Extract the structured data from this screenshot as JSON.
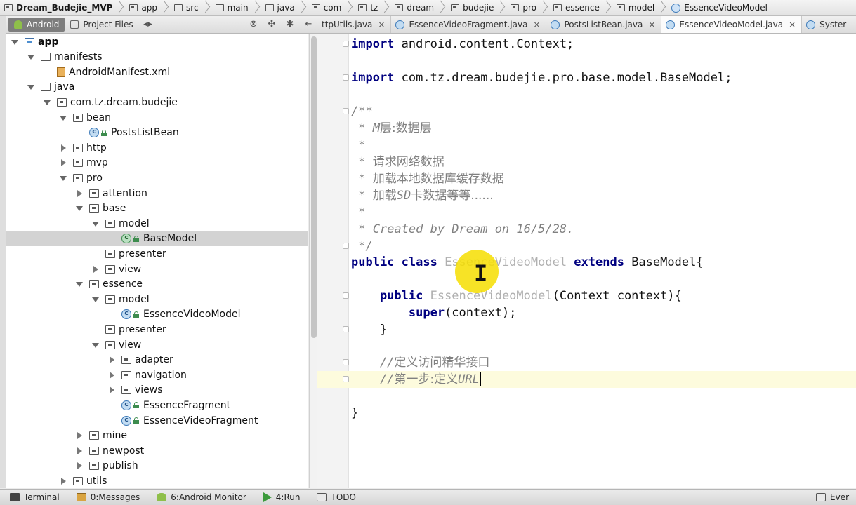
{
  "breadcrumb": [
    {
      "label": "Dream_Budejie_MVP",
      "icon": "module-folder-icon"
    },
    {
      "label": "app",
      "icon": "module-folder-icon"
    },
    {
      "label": "src",
      "icon": "folder-icon"
    },
    {
      "label": "main",
      "icon": "folder-icon"
    },
    {
      "label": "java",
      "icon": "folder-icon"
    },
    {
      "label": "com",
      "icon": "package-icon"
    },
    {
      "label": "tz",
      "icon": "package-icon"
    },
    {
      "label": "dream",
      "icon": "package-icon"
    },
    {
      "label": "budejie",
      "icon": "package-icon"
    },
    {
      "label": "pro",
      "icon": "package-icon"
    },
    {
      "label": "essence",
      "icon": "package-icon"
    },
    {
      "label": "model",
      "icon": "package-icon"
    },
    {
      "label": "EssenceVideoModel",
      "icon": "class-icon"
    }
  ],
  "left_panel": {
    "tab_android": "Android",
    "tab_project_files": "Project Files"
  },
  "tree": [
    {
      "label": "app",
      "arrow": "down",
      "icon": "module",
      "indent": 0,
      "bold": true
    },
    {
      "label": "manifests",
      "arrow": "down",
      "icon": "folder",
      "indent": 1
    },
    {
      "label": "AndroidManifest.xml",
      "arrow": "none",
      "icon": "xml",
      "indent": 2
    },
    {
      "label": "java",
      "arrow": "down",
      "icon": "folder",
      "indent": 1
    },
    {
      "label": "com.tz.dream.budejie",
      "arrow": "down",
      "icon": "package",
      "indent": 2
    },
    {
      "label": "bean",
      "arrow": "down",
      "icon": "package",
      "indent": 3
    },
    {
      "label": "PostsListBean",
      "arrow": "none",
      "icon": "class",
      "indent": 4
    },
    {
      "label": "http",
      "arrow": "right",
      "icon": "package",
      "indent": 3
    },
    {
      "label": "mvp",
      "arrow": "right",
      "icon": "package",
      "indent": 3
    },
    {
      "label": "pro",
      "arrow": "down",
      "icon": "package",
      "indent": 3
    },
    {
      "label": "attention",
      "arrow": "right",
      "icon": "package",
      "indent": 4
    },
    {
      "label": "base",
      "arrow": "down",
      "icon": "package",
      "indent": 4
    },
    {
      "label": "model",
      "arrow": "down",
      "icon": "package",
      "indent": 5
    },
    {
      "label": "BaseModel",
      "arrow": "none",
      "icon": "abstract-class",
      "indent": 6,
      "selected": true
    },
    {
      "label": "presenter",
      "arrow": "none",
      "icon": "package",
      "indent": 5
    },
    {
      "label": "view",
      "arrow": "right",
      "icon": "package",
      "indent": 5
    },
    {
      "label": "essence",
      "arrow": "down",
      "icon": "package",
      "indent": 4
    },
    {
      "label": "model",
      "arrow": "down",
      "icon": "package",
      "indent": 5
    },
    {
      "label": "EssenceVideoModel",
      "arrow": "none",
      "icon": "class",
      "indent": 6
    },
    {
      "label": "presenter",
      "arrow": "none",
      "icon": "package",
      "indent": 5
    },
    {
      "label": "view",
      "arrow": "down",
      "icon": "package",
      "indent": 5
    },
    {
      "label": "adapter",
      "arrow": "right",
      "icon": "package",
      "indent": 6
    },
    {
      "label": "navigation",
      "arrow": "right",
      "icon": "package",
      "indent": 6
    },
    {
      "label": "views",
      "arrow": "right",
      "icon": "package",
      "indent": 6
    },
    {
      "label": "EssenceFragment",
      "arrow": "none",
      "icon": "class",
      "indent": 6
    },
    {
      "label": "EssenceVideoFragment",
      "arrow": "none",
      "icon": "class",
      "indent": 6
    },
    {
      "label": "mine",
      "arrow": "right",
      "icon": "package",
      "indent": 4
    },
    {
      "label": "newpost",
      "arrow": "right",
      "icon": "package",
      "indent": 4
    },
    {
      "label": "publish",
      "arrow": "right",
      "icon": "package",
      "indent": 4
    },
    {
      "label": "utils",
      "arrow": "right",
      "icon": "package",
      "indent": 3
    }
  ],
  "editor_tabs": [
    {
      "label": "ttpUtils.java",
      "close": "×",
      "active": false
    },
    {
      "label": "EssenceVideoFragment.java",
      "close": "×",
      "active": false
    },
    {
      "label": "PostsListBean.java",
      "close": "×",
      "active": false
    },
    {
      "label": "EssenceVideoModel.java",
      "close": "×",
      "active": true
    },
    {
      "label": "Syster",
      "close": "",
      "active": false
    }
  ],
  "code": {
    "l1_kw": "import",
    "l1_rest": " android.content.Context;",
    "l2_kw": "import",
    "l2_rest": " com.tz.dream.budejie.pro.base.model.BaseModel;",
    "l3": "/**",
    "l4_star": " * ",
    "l4_m": "M",
    "l4_cn": "层:数据层",
    "l5": " *",
    "l6_star": " * ",
    "l6_cn": "请求网络数据",
    "l7_star": " * ",
    "l7_cn": "加载本地数据库缓存数据",
    "l8_star": " * ",
    "l8_cn1": "加载",
    "l8_sd": "SD",
    "l8_cn2": "卡数据等等......",
    "l9": " *",
    "l10": " * Created by Dream on 16/5/28.",
    "l11": " */",
    "l12_kw1": "public class ",
    "l12_name": "EssenceVideoModel",
    "l12_kw2": " extends ",
    "l12_rest": "BaseModel{",
    "l13_kw": "    public ",
    "l13_name": "EssenceVideoModel",
    "l13_rest": "(Context context){",
    "l14_kw": "        super",
    "l14_rest": "(context);",
    "l15": "    }",
    "l16_slash": "    //",
    "l16_cn": "定义访问精华接口",
    "l17_slash": "    //",
    "l17_cn": "第一步:定义",
    "l17_url": "URL",
    "l18": "}"
  },
  "statusbar": [
    {
      "label": "Terminal",
      "icon": "terminal-icon",
      "mn": ""
    },
    {
      "label": "Messages",
      "icon": "messages-icon",
      "mn": "0: "
    },
    {
      "label": "Android Monitor",
      "icon": "android-icon",
      "mn": "6: "
    },
    {
      "label": "Run",
      "icon": "run-icon",
      "mn": "4: "
    },
    {
      "label": "TODO",
      "icon": "todo-icon",
      "mn": ""
    },
    {
      "label": "Ever",
      "icon": "event-icon",
      "mn": ""
    }
  ]
}
